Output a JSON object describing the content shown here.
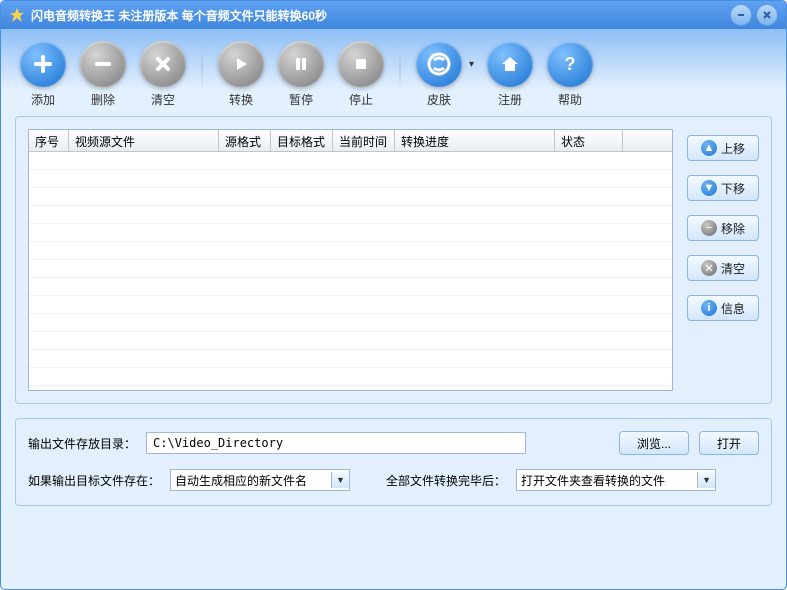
{
  "window": {
    "title": "闪电音频转换王  未注册版本 每个音频文件只能转换60秒"
  },
  "toolbar": {
    "add": "添加",
    "delete": "删除",
    "clear": "清空",
    "convert": "转换",
    "pause": "暂停",
    "stop": "停止",
    "skin": "皮肤",
    "register": "注册",
    "help": "帮助"
  },
  "table": {
    "headers": {
      "index": "序号",
      "source": "视频源文件",
      "src_format": "源格式",
      "dst_format": "目标格式",
      "time": "当前时间",
      "progress": "转换进度",
      "status": "状态"
    },
    "rows": []
  },
  "side": {
    "up": "上移",
    "down": "下移",
    "remove": "移除",
    "clear": "清空",
    "info": "信息"
  },
  "bottom": {
    "output_dir_label": "输出文件存放目录：",
    "output_dir_value": "C:\\Video_Directory",
    "browse": "浏览...",
    "open": "打开",
    "if_exists_label": "如果输出目标文件存在：",
    "if_exists_value": "自动生成相应的新文件名",
    "after_all_label": "全部文件转换完毕后：",
    "after_all_value": "打开文件夹查看转换的文件"
  }
}
